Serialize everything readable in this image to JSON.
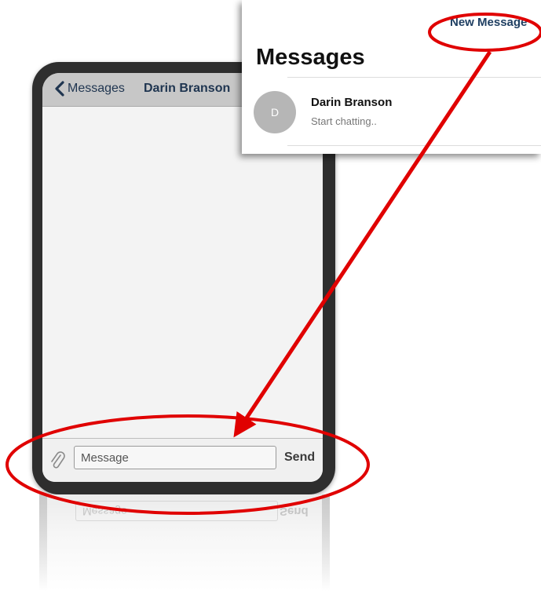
{
  "conversation": {
    "back_label": "Messages",
    "title": "Darin Branson",
    "message_placeholder": "Message",
    "send_label": "Send"
  },
  "messages_list": {
    "new_message_label": "New Message",
    "title": "Messages",
    "items": [
      {
        "avatar_initial": "D",
        "name": "Darin Branson",
        "preview": "Start chatting.."
      }
    ]
  },
  "icons": {
    "back": "chevron-left-icon",
    "attach": "paperclip-icon"
  },
  "colors": {
    "annotation": "#e00000",
    "nav_text": "#1f3550",
    "link": "#1f3f62",
    "avatar_bg": "#b6b6b6"
  }
}
